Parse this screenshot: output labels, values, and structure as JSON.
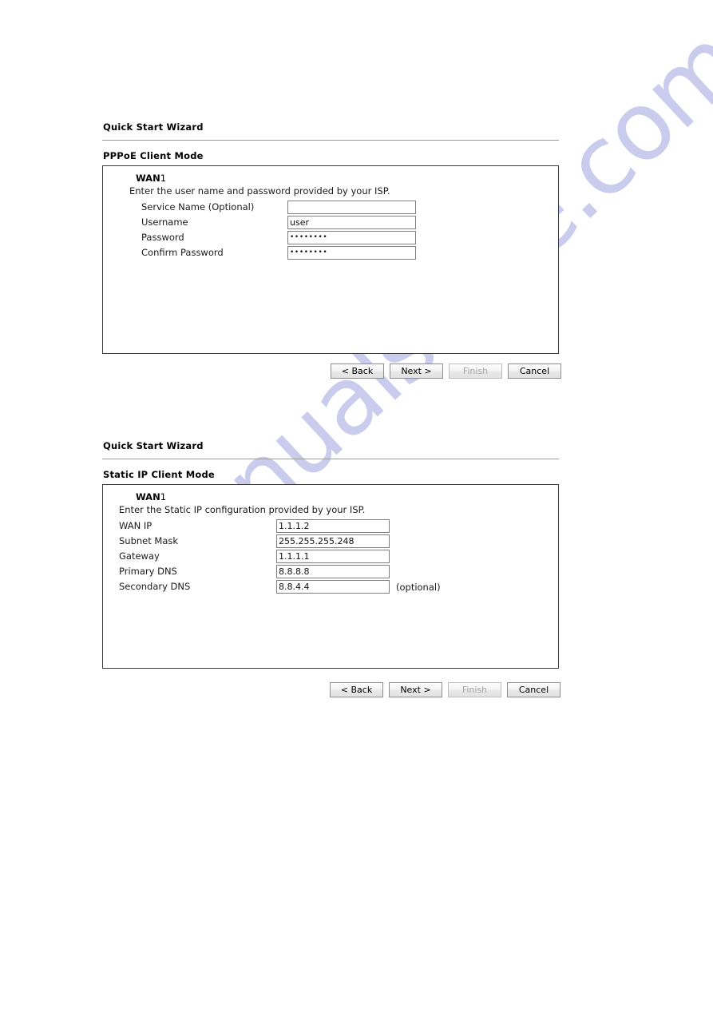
{
  "watermark": {
    "text": "manualshive.com"
  },
  "sections": [
    {
      "title": "Quick Start Wizard",
      "mode_label": "PPPoE Client Mode",
      "wan_label": "WAN",
      "wan_number": "1",
      "description": "Enter the user name and password provided by your ISP.",
      "fields": [
        {
          "label": "Service Name (Optional)",
          "value": "",
          "masked": false,
          "note": ""
        },
        {
          "label": "Username",
          "value": "user",
          "masked": false,
          "note": ""
        },
        {
          "label": "Password",
          "value": "••••••••",
          "masked": true,
          "note": ""
        },
        {
          "label": "Confirm Password",
          "value": "••••••••",
          "masked": true,
          "note": ""
        }
      ],
      "buttons": [
        {
          "label": "< Back",
          "disabled": false
        },
        {
          "label": "Next >",
          "disabled": false
        },
        {
          "label": "Finish",
          "disabled": true
        },
        {
          "label": "Cancel",
          "disabled": false
        }
      ]
    },
    {
      "title": "Quick Start Wizard",
      "mode_label": "Static IP Client Mode",
      "wan_label": "WAN",
      "wan_number": "1",
      "description": "Enter the Static IP configuration provided by your ISP.",
      "fields": [
        {
          "label": "WAN IP",
          "value": "1.1.1.2",
          "masked": false,
          "note": ""
        },
        {
          "label": "Subnet Mask",
          "value": "255.255.255.248",
          "masked": false,
          "note": ""
        },
        {
          "label": "Gateway",
          "value": "1.1.1.1",
          "masked": false,
          "note": ""
        },
        {
          "label": "Primary DNS",
          "value": "8.8.8.8",
          "masked": false,
          "note": ""
        },
        {
          "label": "Secondary DNS",
          "value": "8.8.4.4",
          "masked": false,
          "note": "(optional)"
        }
      ],
      "buttons": [
        {
          "label": "< Back",
          "disabled": false
        },
        {
          "label": "Next >",
          "disabled": false
        },
        {
          "label": "Finish",
          "disabled": true
        },
        {
          "label": "Cancel",
          "disabled": false
        }
      ]
    }
  ]
}
